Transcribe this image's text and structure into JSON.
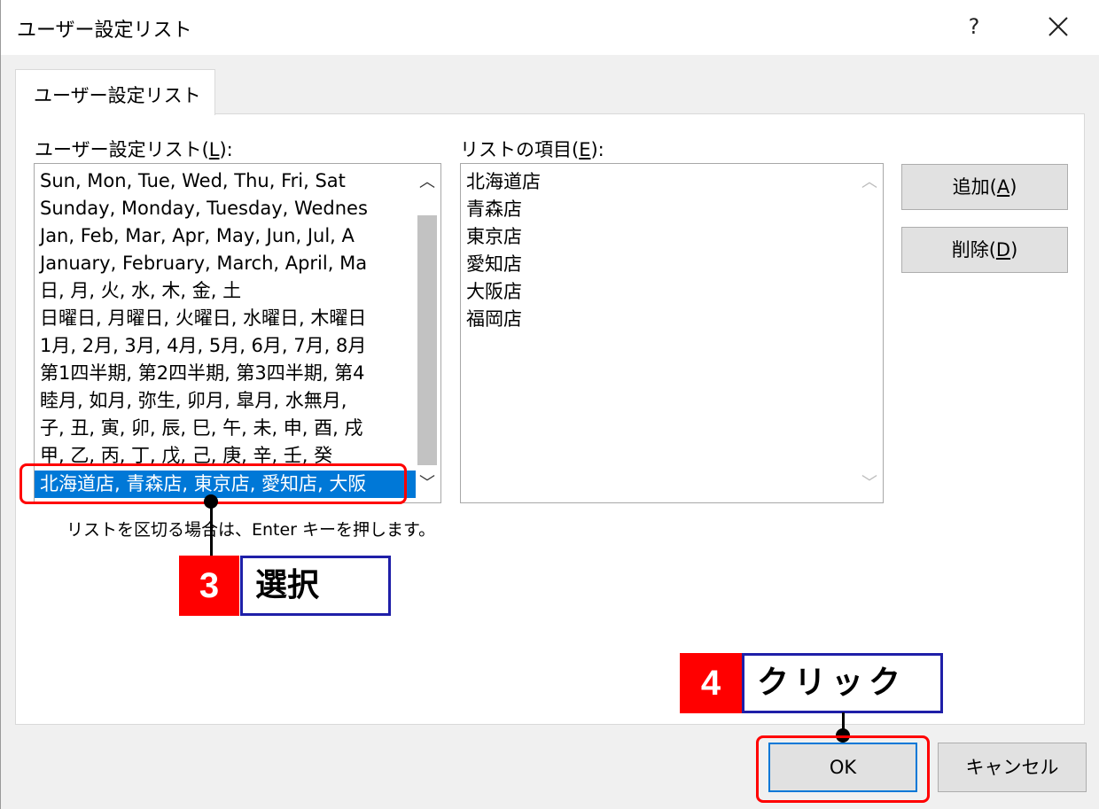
{
  "window": {
    "title": "ユーザー設定リスト",
    "help_label": "?",
    "close_icon": "close-icon"
  },
  "tabs": [
    {
      "label": "ユーザー設定リスト",
      "active": true
    }
  ],
  "custom_lists": {
    "label_prefix": "ユーザー設定リスト(",
    "label_key": "L",
    "label_suffix": "):",
    "items": [
      "Sun, Mon, Tue, Wed, Thu, Fri, Sat",
      "Sunday, Monday, Tuesday, Wednes",
      "Jan, Feb, Mar, Apr, May, Jun, Jul, A",
      "January, February, March, April, Ma",
      "日, 月, 火, 水, 木, 金, 土",
      "日曜日, 月曜日, 火曜日, 水曜日, 木曜日",
      "1月, 2月, 3月, 4月, 5月, 6月, 7月, 8月",
      "第1四半期, 第2四半期, 第3四半期, 第4",
      "睦月, 如月, 弥生, 卯月, 皐月, 水無月,",
      "子, 丑, 寅, 卯, 辰, 巳, 午, 未, 申, 酉, 戌",
      "甲, 乙, 丙, 丁, 戊, 己, 庚, 辛, 壬, 癸",
      "北海道店, 青森店, 東京店, 愛知店, 大阪"
    ],
    "selected_index": 11
  },
  "list_entries": {
    "label_prefix": "リストの項目(",
    "label_key": "E",
    "label_suffix": "):",
    "items": [
      "北海道店",
      "青森店",
      "東京店",
      "愛知店",
      "大阪店",
      "福岡店"
    ]
  },
  "buttons": {
    "add_prefix": "追加(",
    "add_key": "A",
    "add_suffix": ")",
    "delete_prefix": "削除(",
    "delete_key": "D",
    "delete_suffix": ")",
    "ok": "OK",
    "cancel": "キャンセル"
  },
  "hint": "リストを区切る場合は、Enter キーを押します。",
  "annotations": {
    "step3": {
      "number": "3",
      "label": "選択"
    },
    "step4": {
      "number": "4",
      "label": "クリック"
    }
  },
  "colors": {
    "selection": "#0078d7",
    "highlight_frame": "#ff0000",
    "step_badge": "#ff0000",
    "label_border": "#1f1fa8"
  }
}
